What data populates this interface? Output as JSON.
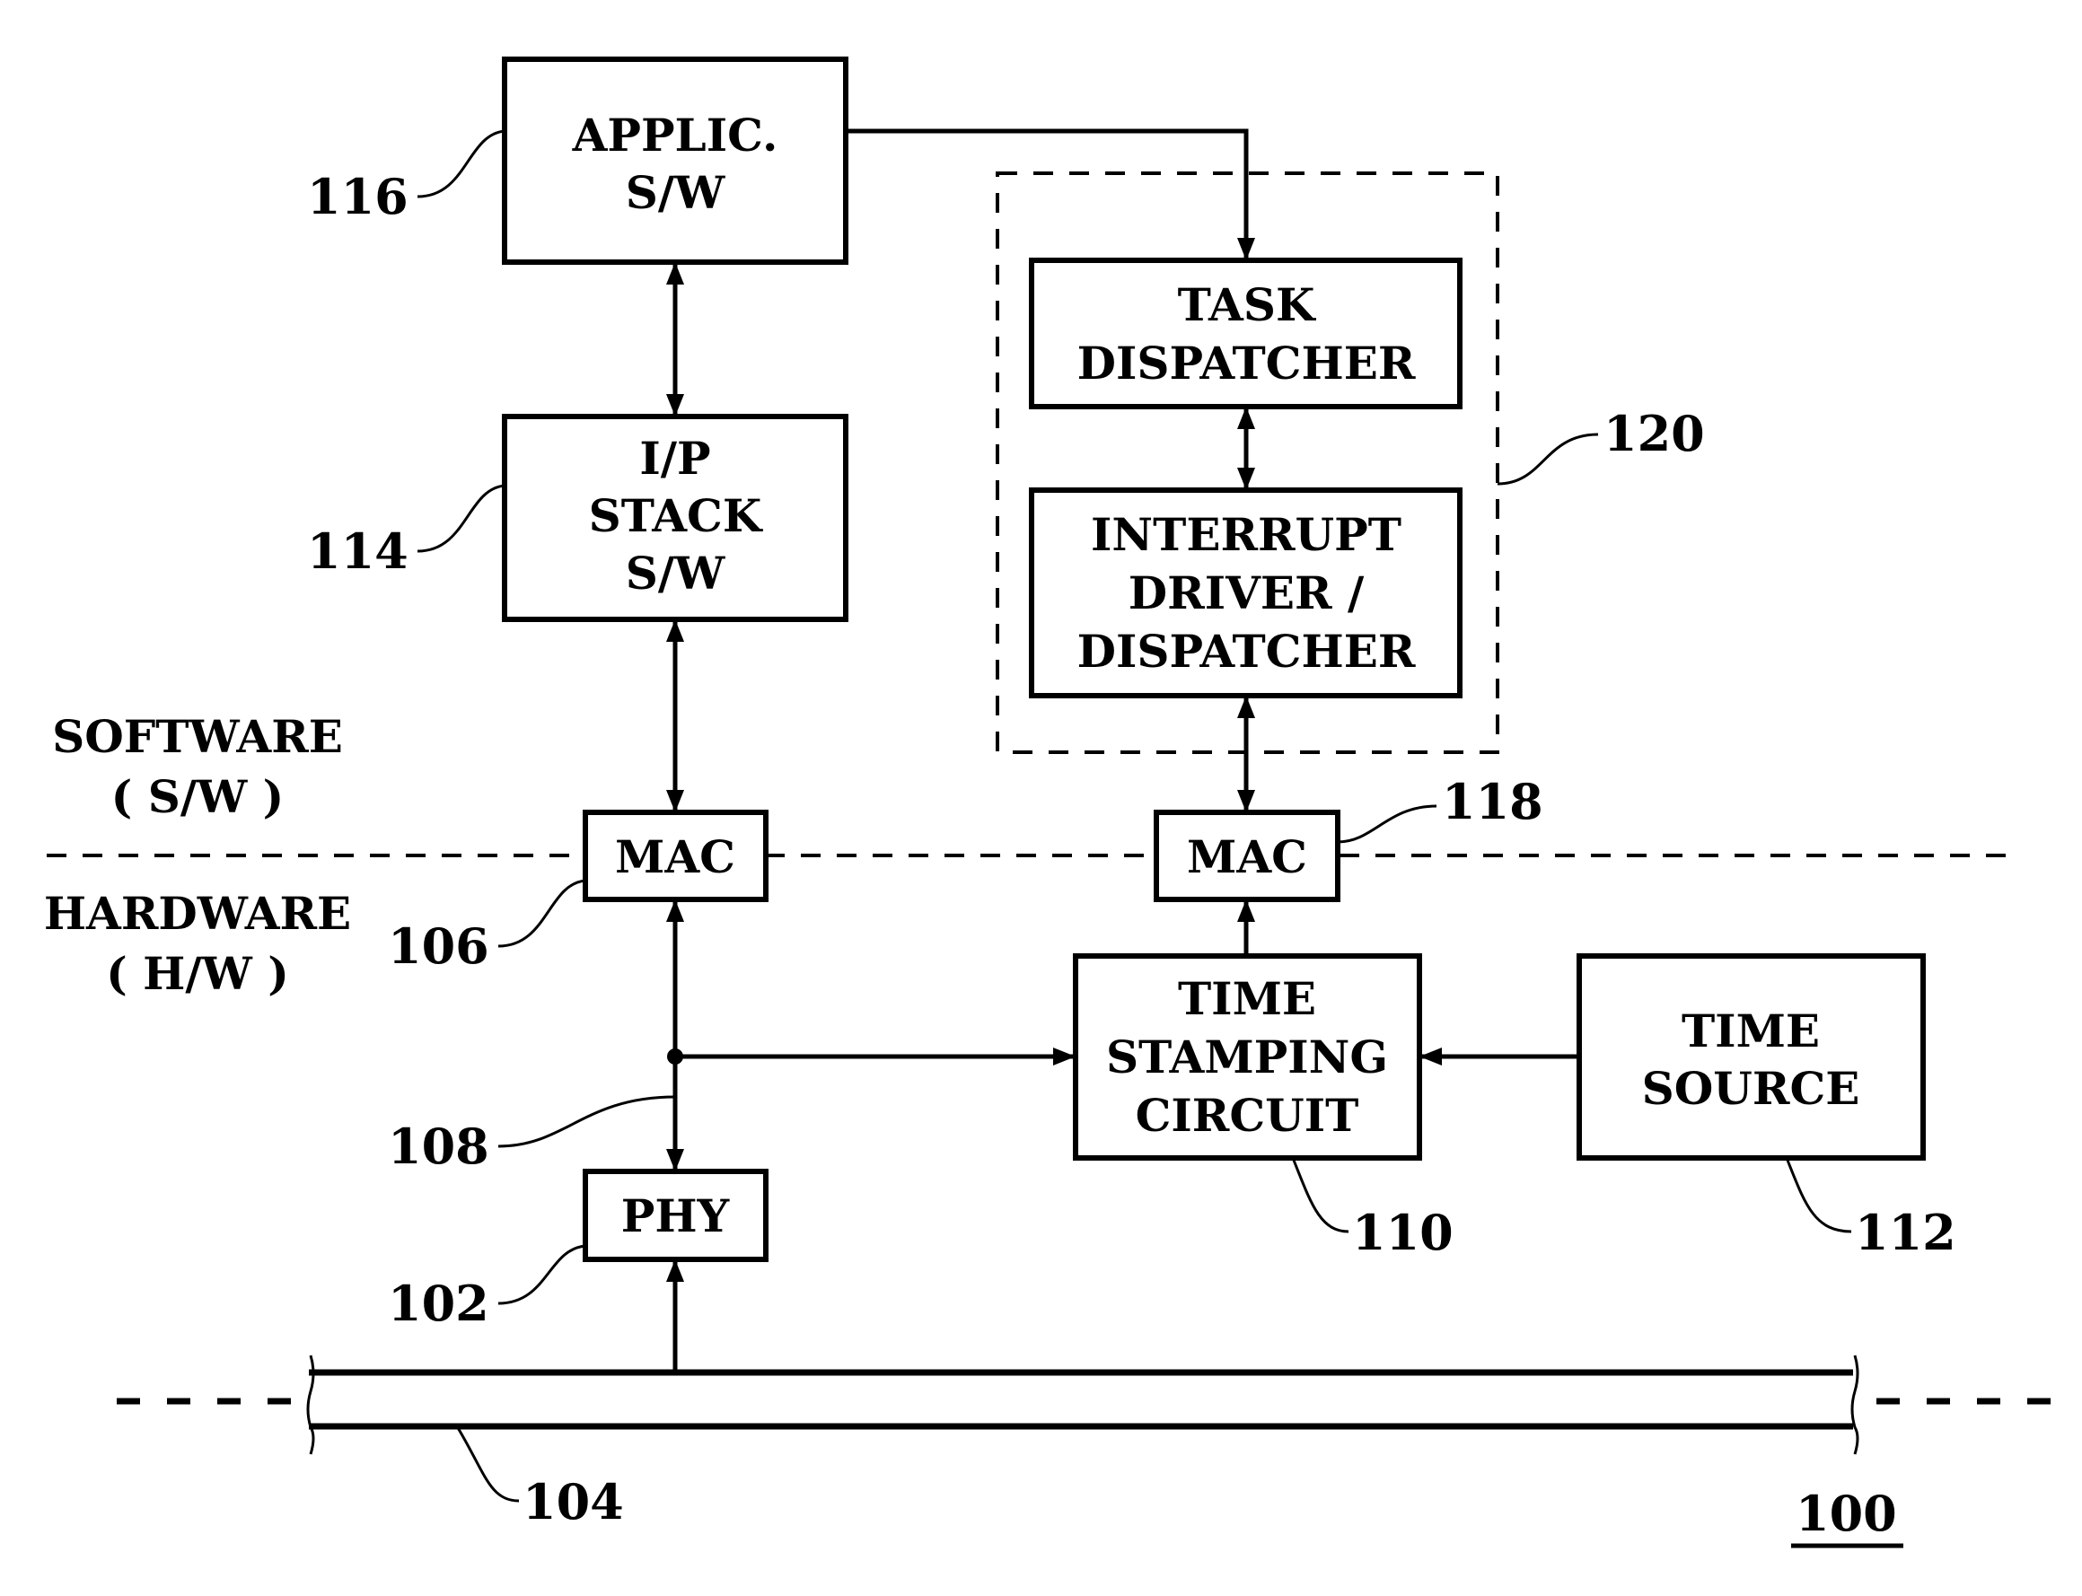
{
  "figure_number": "100",
  "regions": {
    "software": [
      "SOFTWARE",
      "( S/W )"
    ],
    "hardware": [
      "HARDWARE",
      "( H/W )"
    ]
  },
  "blocks": {
    "applic": {
      "lines": [
        "APPLIC.",
        "S/W"
      ],
      "ref": "116"
    },
    "ipstack": {
      "lines": [
        "I/P",
        "STACK",
        "S/W"
      ],
      "ref": "114"
    },
    "mac_left": {
      "lines": [
        "MAC"
      ],
      "ref": "106"
    },
    "mac_right": {
      "lines": [
        "MAC"
      ],
      "ref": "118"
    },
    "task_dispatcher": {
      "lines": [
        "TASK",
        "DISPATCHER"
      ]
    },
    "interrupt": {
      "lines": [
        "INTERRUPT",
        "DRIVER /",
        "DISPATCHER"
      ]
    },
    "dispatch_group": {
      "ref": "120"
    },
    "time_stamping": {
      "lines": [
        "TIME",
        "STAMPING",
        "CIRCUIT"
      ],
      "ref": "110"
    },
    "time_source": {
      "lines": [
        "TIME",
        "SOURCE"
      ],
      "ref": "112"
    },
    "phy": {
      "lines": [
        "PHY"
      ],
      "ref": "102"
    },
    "junction": {
      "ref": "108"
    },
    "bus": {
      "ref": "104"
    }
  }
}
